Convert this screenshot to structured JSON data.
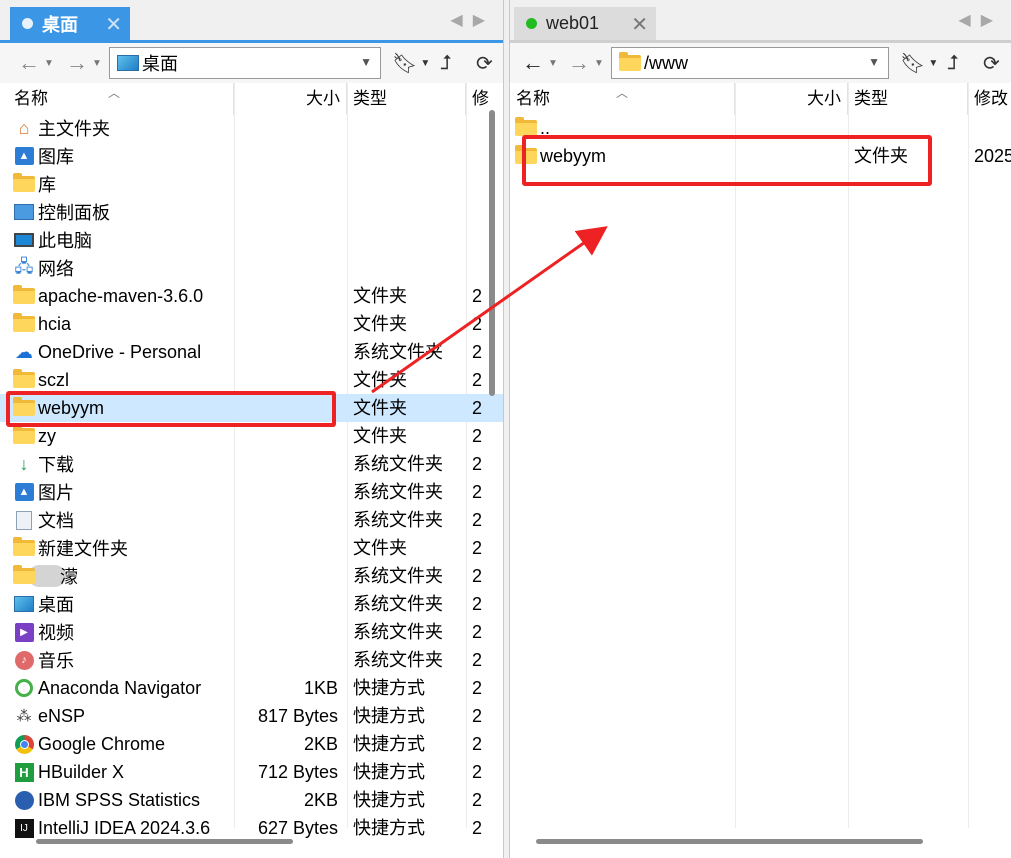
{
  "left": {
    "tab_title": "桌面",
    "path": "桌面",
    "columns": {
      "name": "名称",
      "size": "大小",
      "type": "类型",
      "modified": "修"
    },
    "files": [
      {
        "name": "主文件夹",
        "size": "",
        "type": "",
        "mod": "",
        "icon": "home-icon"
      },
      {
        "name": "图库",
        "size": "",
        "type": "",
        "mod": "",
        "icon": "gallery-icon"
      },
      {
        "name": "库",
        "size": "",
        "type": "",
        "mod": "",
        "icon": "folder-icon"
      },
      {
        "name": "控制面板",
        "size": "",
        "type": "",
        "mod": "",
        "icon": "control-panel-icon"
      },
      {
        "name": "此电脑",
        "size": "",
        "type": "",
        "mod": "",
        "icon": "computer-icon"
      },
      {
        "name": "网络",
        "size": "",
        "type": "",
        "mod": "",
        "icon": "network-icon"
      },
      {
        "name": "apache-maven-3.6.0",
        "size": "",
        "type": "文件夹",
        "mod": "2",
        "icon": "folder-icon"
      },
      {
        "name": "hcia",
        "size": "",
        "type": "文件夹",
        "mod": "2",
        "icon": "folder-icon"
      },
      {
        "name": "OneDrive - Personal",
        "size": "",
        "type": "系统文件夹",
        "mod": "2",
        "icon": "onedrive-icon"
      },
      {
        "name": "sczl",
        "size": "",
        "type": "文件夹",
        "mod": "2",
        "icon": "folder-icon"
      },
      {
        "name": "webyym",
        "size": "",
        "type": "文件夹",
        "mod": "2",
        "icon": "folder-icon"
      },
      {
        "name": "zy",
        "size": "",
        "type": "文件夹",
        "mod": "2",
        "icon": "folder-icon"
      },
      {
        "name": "下载",
        "size": "",
        "type": "系统文件夹",
        "mod": "2",
        "icon": "download-icon"
      },
      {
        "name": "图片",
        "size": "",
        "type": "系统文件夹",
        "mod": "2",
        "icon": "pictures-icon"
      },
      {
        "name": "文档",
        "size": "",
        "type": "系统文件夹",
        "mod": "2",
        "icon": "documents-icon"
      },
      {
        "name": "新建文件夹",
        "size": "",
        "type": "文件夹",
        "mod": "2",
        "icon": "folder-icon"
      },
      {
        "name": "濛",
        "size": "",
        "type": "系统文件夹",
        "mod": "2",
        "icon": "folder-icon"
      },
      {
        "name": "桌面",
        "size": "",
        "type": "系统文件夹",
        "mod": "2",
        "icon": "desktop-icon"
      },
      {
        "name": "视频",
        "size": "",
        "type": "系统文件夹",
        "mod": "2",
        "icon": "videos-icon"
      },
      {
        "name": "音乐",
        "size": "",
        "type": "系统文件夹",
        "mod": "2",
        "icon": "music-icon"
      },
      {
        "name": "Anaconda Navigator",
        "size": "1KB",
        "type": "快捷方式",
        "mod": "2",
        "icon": "anaconda-icon"
      },
      {
        "name": "eNSP",
        "size": "817 Bytes",
        "type": "快捷方式",
        "mod": "2",
        "icon": "ensp-icon"
      },
      {
        "name": "Google Chrome",
        "size": "2KB",
        "type": "快捷方式",
        "mod": "2",
        "icon": "chrome-icon"
      },
      {
        "name": "HBuilder X",
        "size": "712 Bytes",
        "type": "快捷方式",
        "mod": "2",
        "icon": "hbuilder-icon"
      },
      {
        "name": "IBM SPSS Statistics",
        "size": "2KB",
        "type": "快捷方式",
        "mod": "2",
        "icon": "spss-icon"
      },
      {
        "name": "IntelliJ IDEA 2024.3.6",
        "size": "627 Bytes",
        "type": "快捷方式",
        "mod": "2",
        "icon": "intellij-icon"
      }
    ]
  },
  "right": {
    "tab_title": "web01",
    "path": "/www",
    "columns": {
      "name": "名称",
      "size": "大小",
      "type": "类型",
      "modified": "修改"
    },
    "files": [
      {
        "name": "..",
        "size": "",
        "type": "",
        "mod": "",
        "icon": "folder-icon"
      },
      {
        "name": "webyym",
        "size": "",
        "type": "文件夹",
        "mod": "2025",
        "icon": "folder-icon"
      }
    ]
  },
  "colors": {
    "accent": "#3c96e6",
    "highlight": "#ee2222",
    "selection": "#cde8ff",
    "status_green": "#22bb22"
  }
}
